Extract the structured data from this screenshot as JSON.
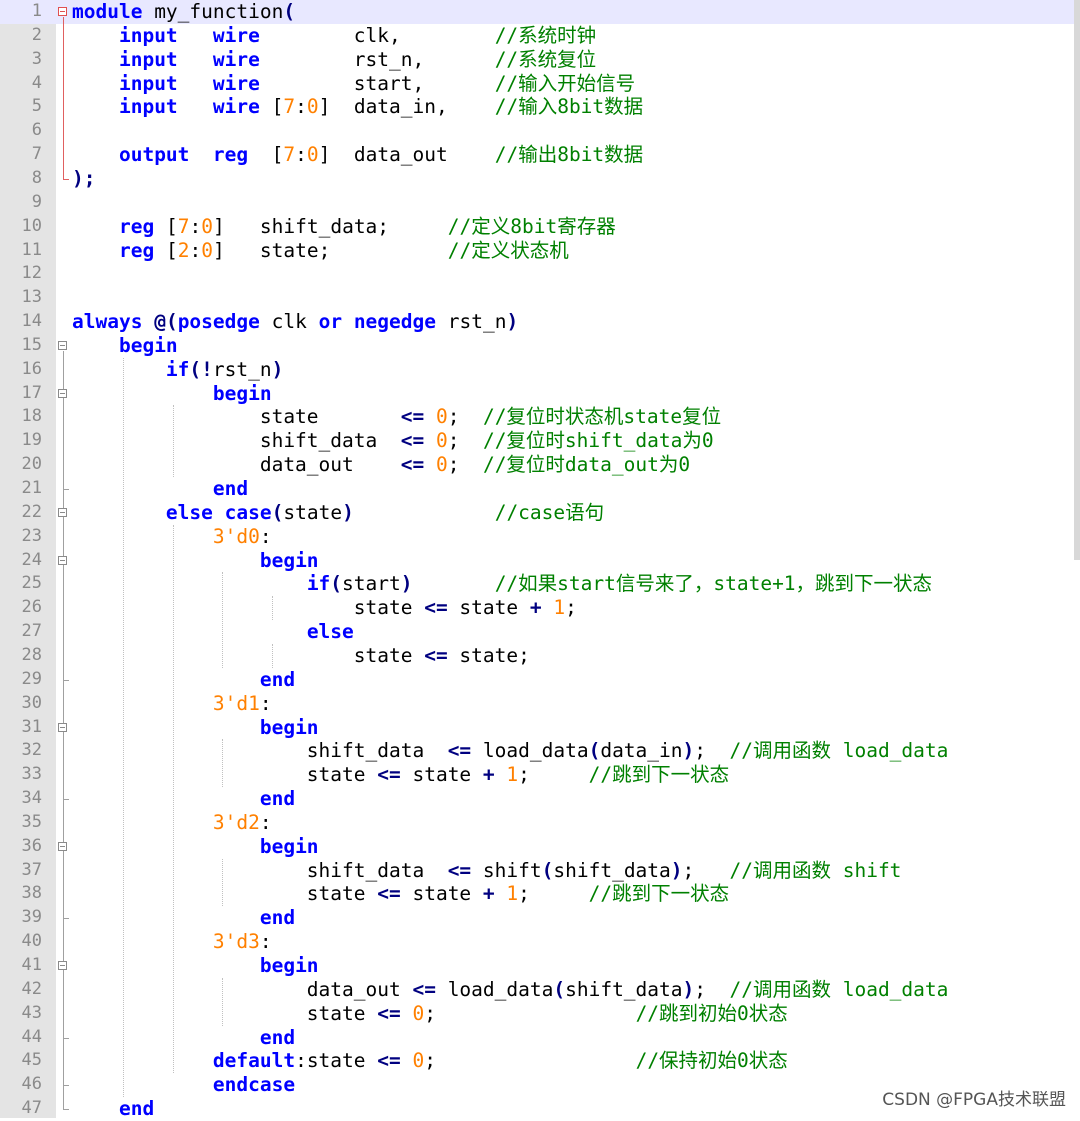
{
  "editor": {
    "current_line": 1,
    "lines": [
      {
        "n": "1",
        "tokens": [
          {
            "t": "kw",
            "v": "module"
          },
          {
            "t": "tx",
            "v": " my_function"
          },
          {
            "t": "op",
            "v": "("
          }
        ]
      },
      {
        "n": "2",
        "tokens": [
          {
            "t": "tx",
            "v": "    "
          },
          {
            "t": "kw",
            "v": "input"
          },
          {
            "t": "tx",
            "v": "   "
          },
          {
            "t": "kw",
            "v": "wire"
          },
          {
            "t": "tx",
            "v": "        clk,        "
          },
          {
            "t": "cm",
            "v": "//系统时钟"
          }
        ]
      },
      {
        "n": "3",
        "tokens": [
          {
            "t": "tx",
            "v": "    "
          },
          {
            "t": "kw",
            "v": "input"
          },
          {
            "t": "tx",
            "v": "   "
          },
          {
            "t": "kw",
            "v": "wire"
          },
          {
            "t": "tx",
            "v": "        rst_n,      "
          },
          {
            "t": "cm",
            "v": "//系统复位"
          }
        ]
      },
      {
        "n": "4",
        "tokens": [
          {
            "t": "tx",
            "v": "    "
          },
          {
            "t": "kw",
            "v": "input"
          },
          {
            "t": "tx",
            "v": "   "
          },
          {
            "t": "kw",
            "v": "wire"
          },
          {
            "t": "tx",
            "v": "        start,      "
          },
          {
            "t": "cm",
            "v": "//输入开始信号"
          }
        ]
      },
      {
        "n": "5",
        "tokens": [
          {
            "t": "tx",
            "v": "    "
          },
          {
            "t": "kw",
            "v": "input"
          },
          {
            "t": "tx",
            "v": "   "
          },
          {
            "t": "kw",
            "v": "wire"
          },
          {
            "t": "tx",
            "v": " ["
          },
          {
            "t": "num",
            "v": "7"
          },
          {
            "t": "tx",
            "v": ":"
          },
          {
            "t": "num",
            "v": "0"
          },
          {
            "t": "tx",
            "v": "]  data_in,    "
          },
          {
            "t": "cm",
            "v": "//输入8bit数据"
          }
        ]
      },
      {
        "n": "6",
        "tokens": []
      },
      {
        "n": "7",
        "tokens": [
          {
            "t": "tx",
            "v": "    "
          },
          {
            "t": "kw",
            "v": "output"
          },
          {
            "t": "tx",
            "v": "  "
          },
          {
            "t": "kw",
            "v": "reg"
          },
          {
            "t": "tx",
            "v": "  ["
          },
          {
            "t": "num",
            "v": "7"
          },
          {
            "t": "tx",
            "v": ":"
          },
          {
            "t": "num",
            "v": "0"
          },
          {
            "t": "tx",
            "v": "]  data_out    "
          },
          {
            "t": "cm",
            "v": "//输出8bit数据"
          }
        ]
      },
      {
        "n": "8",
        "tokens": [
          {
            "t": "op",
            "v": ");"
          }
        ]
      },
      {
        "n": "9",
        "tokens": []
      },
      {
        "n": "10",
        "tokens": [
          {
            "t": "tx",
            "v": "    "
          },
          {
            "t": "kw",
            "v": "reg"
          },
          {
            "t": "tx",
            "v": " ["
          },
          {
            "t": "num",
            "v": "7"
          },
          {
            "t": "tx",
            "v": ":"
          },
          {
            "t": "num",
            "v": "0"
          },
          {
            "t": "tx",
            "v": "]   shift_data;     "
          },
          {
            "t": "cm",
            "v": "//定义8bit寄存器"
          }
        ]
      },
      {
        "n": "11",
        "tokens": [
          {
            "t": "tx",
            "v": "    "
          },
          {
            "t": "kw",
            "v": "reg"
          },
          {
            "t": "tx",
            "v": " ["
          },
          {
            "t": "num",
            "v": "2"
          },
          {
            "t": "tx",
            "v": ":"
          },
          {
            "t": "num",
            "v": "0"
          },
          {
            "t": "tx",
            "v": "]   state;          "
          },
          {
            "t": "cm",
            "v": "//定义状态机"
          }
        ]
      },
      {
        "n": "12",
        "tokens": []
      },
      {
        "n": "13",
        "tokens": []
      },
      {
        "n": "14",
        "tokens": [
          {
            "t": "kw",
            "v": "always"
          },
          {
            "t": "tx",
            "v": " "
          },
          {
            "t": "op",
            "v": "@("
          },
          {
            "t": "kw",
            "v": "posedge"
          },
          {
            "t": "tx",
            "v": " clk "
          },
          {
            "t": "kw",
            "v": "or"
          },
          {
            "t": "tx",
            "v": " "
          },
          {
            "t": "kw",
            "v": "negedge"
          },
          {
            "t": "tx",
            "v": " rst_n"
          },
          {
            "t": "op",
            "v": ")"
          }
        ]
      },
      {
        "n": "15",
        "tokens": [
          {
            "t": "tx",
            "v": "    "
          },
          {
            "t": "kw",
            "v": "begin"
          }
        ]
      },
      {
        "n": "16",
        "tokens": [
          {
            "t": "tx",
            "v": "        "
          },
          {
            "t": "kw",
            "v": "if"
          },
          {
            "t": "op",
            "v": "(!"
          },
          {
            "t": "tx",
            "v": "rst_n"
          },
          {
            "t": "op",
            "v": ")"
          }
        ]
      },
      {
        "n": "17",
        "tokens": [
          {
            "t": "tx",
            "v": "            "
          },
          {
            "t": "kw",
            "v": "begin"
          }
        ]
      },
      {
        "n": "18",
        "tokens": [
          {
            "t": "tx",
            "v": "                state       "
          },
          {
            "t": "op",
            "v": "<="
          },
          {
            "t": "tx",
            "v": " "
          },
          {
            "t": "num",
            "v": "0"
          },
          {
            "t": "tx",
            "v": ";  "
          },
          {
            "t": "cm",
            "v": "//复位时状态机state复位"
          }
        ]
      },
      {
        "n": "19",
        "tokens": [
          {
            "t": "tx",
            "v": "                shift_data  "
          },
          {
            "t": "op",
            "v": "<="
          },
          {
            "t": "tx",
            "v": " "
          },
          {
            "t": "num",
            "v": "0"
          },
          {
            "t": "tx",
            "v": ";  "
          },
          {
            "t": "cm",
            "v": "//复位时shift_data为0"
          }
        ]
      },
      {
        "n": "20",
        "tokens": [
          {
            "t": "tx",
            "v": "                data_out    "
          },
          {
            "t": "op",
            "v": "<="
          },
          {
            "t": "tx",
            "v": " "
          },
          {
            "t": "num",
            "v": "0"
          },
          {
            "t": "tx",
            "v": ";  "
          },
          {
            "t": "cm",
            "v": "//复位时data_out为0"
          }
        ]
      },
      {
        "n": "21",
        "tokens": [
          {
            "t": "tx",
            "v": "            "
          },
          {
            "t": "kw",
            "v": "end"
          }
        ]
      },
      {
        "n": "22",
        "tokens": [
          {
            "t": "tx",
            "v": "        "
          },
          {
            "t": "kw",
            "v": "else"
          },
          {
            "t": "tx",
            "v": " "
          },
          {
            "t": "kw",
            "v": "case"
          },
          {
            "t": "op",
            "v": "("
          },
          {
            "t": "tx",
            "v": "state"
          },
          {
            "t": "op",
            "v": ")"
          },
          {
            "t": "tx",
            "v": "            "
          },
          {
            "t": "cm",
            "v": "//case语句"
          }
        ]
      },
      {
        "n": "23",
        "tokens": [
          {
            "t": "tx",
            "v": "            "
          },
          {
            "t": "num",
            "v": "3'd0"
          },
          {
            "t": "tx",
            "v": ":"
          }
        ]
      },
      {
        "n": "24",
        "tokens": [
          {
            "t": "tx",
            "v": "                "
          },
          {
            "t": "kw",
            "v": "begin"
          }
        ]
      },
      {
        "n": "25",
        "tokens": [
          {
            "t": "tx",
            "v": "                    "
          },
          {
            "t": "kw",
            "v": "if"
          },
          {
            "t": "op",
            "v": "("
          },
          {
            "t": "tx",
            "v": "start"
          },
          {
            "t": "op",
            "v": ")"
          },
          {
            "t": "tx",
            "v": "       "
          },
          {
            "t": "cm",
            "v": "//如果start信号来了，state+1，跳到下一状态"
          }
        ]
      },
      {
        "n": "26",
        "tokens": [
          {
            "t": "tx",
            "v": "                        state "
          },
          {
            "t": "op",
            "v": "<="
          },
          {
            "t": "tx",
            "v": " state "
          },
          {
            "t": "op",
            "v": "+"
          },
          {
            "t": "tx",
            "v": " "
          },
          {
            "t": "num",
            "v": "1"
          },
          {
            "t": "tx",
            "v": ";"
          }
        ]
      },
      {
        "n": "27",
        "tokens": [
          {
            "t": "tx",
            "v": "                    "
          },
          {
            "t": "kw",
            "v": "else"
          }
        ]
      },
      {
        "n": "28",
        "tokens": [
          {
            "t": "tx",
            "v": "                        state "
          },
          {
            "t": "op",
            "v": "<="
          },
          {
            "t": "tx",
            "v": " state;"
          }
        ]
      },
      {
        "n": "29",
        "tokens": [
          {
            "t": "tx",
            "v": "                "
          },
          {
            "t": "kw",
            "v": "end"
          }
        ]
      },
      {
        "n": "30",
        "tokens": [
          {
            "t": "tx",
            "v": "            "
          },
          {
            "t": "num",
            "v": "3'd1"
          },
          {
            "t": "tx",
            "v": ":"
          }
        ]
      },
      {
        "n": "31",
        "tokens": [
          {
            "t": "tx",
            "v": "                "
          },
          {
            "t": "kw",
            "v": "begin"
          }
        ]
      },
      {
        "n": "32",
        "tokens": [
          {
            "t": "tx",
            "v": "                    shift_data  "
          },
          {
            "t": "op",
            "v": "<="
          },
          {
            "t": "tx",
            "v": " load_data"
          },
          {
            "t": "op",
            "v": "("
          },
          {
            "t": "tx",
            "v": "data_in"
          },
          {
            "t": "op",
            "v": ")"
          },
          {
            "t": "tx",
            "v": ";  "
          },
          {
            "t": "cm",
            "v": "//调用函数 load_data"
          }
        ]
      },
      {
        "n": "33",
        "tokens": [
          {
            "t": "tx",
            "v": "                    state "
          },
          {
            "t": "op",
            "v": "<="
          },
          {
            "t": "tx",
            "v": " state "
          },
          {
            "t": "op",
            "v": "+"
          },
          {
            "t": "tx",
            "v": " "
          },
          {
            "t": "num",
            "v": "1"
          },
          {
            "t": "tx",
            "v": ";     "
          },
          {
            "t": "cm",
            "v": "//跳到下一状态"
          }
        ]
      },
      {
        "n": "34",
        "tokens": [
          {
            "t": "tx",
            "v": "                "
          },
          {
            "t": "kw",
            "v": "end"
          }
        ]
      },
      {
        "n": "35",
        "tokens": [
          {
            "t": "tx",
            "v": "            "
          },
          {
            "t": "num",
            "v": "3'd2"
          },
          {
            "t": "tx",
            "v": ":"
          }
        ]
      },
      {
        "n": "36",
        "tokens": [
          {
            "t": "tx",
            "v": "                "
          },
          {
            "t": "kw",
            "v": "begin"
          }
        ]
      },
      {
        "n": "37",
        "tokens": [
          {
            "t": "tx",
            "v": "                    shift_data  "
          },
          {
            "t": "op",
            "v": "<="
          },
          {
            "t": "tx",
            "v": " shift"
          },
          {
            "t": "op",
            "v": "("
          },
          {
            "t": "tx",
            "v": "shift_data"
          },
          {
            "t": "op",
            "v": ")"
          },
          {
            "t": "tx",
            "v": ";   "
          },
          {
            "t": "cm",
            "v": "//调用函数 shift"
          }
        ]
      },
      {
        "n": "38",
        "tokens": [
          {
            "t": "tx",
            "v": "                    state "
          },
          {
            "t": "op",
            "v": "<="
          },
          {
            "t": "tx",
            "v": " state "
          },
          {
            "t": "op",
            "v": "+"
          },
          {
            "t": "tx",
            "v": " "
          },
          {
            "t": "num",
            "v": "1"
          },
          {
            "t": "tx",
            "v": ";     "
          },
          {
            "t": "cm",
            "v": "//跳到下一状态"
          }
        ]
      },
      {
        "n": "39",
        "tokens": [
          {
            "t": "tx",
            "v": "                "
          },
          {
            "t": "kw",
            "v": "end"
          }
        ]
      },
      {
        "n": "40",
        "tokens": [
          {
            "t": "tx",
            "v": "            "
          },
          {
            "t": "num",
            "v": "3'd3"
          },
          {
            "t": "tx",
            "v": ":"
          }
        ]
      },
      {
        "n": "41",
        "tokens": [
          {
            "t": "tx",
            "v": "                "
          },
          {
            "t": "kw",
            "v": "begin"
          }
        ]
      },
      {
        "n": "42",
        "tokens": [
          {
            "t": "tx",
            "v": "                    data_out "
          },
          {
            "t": "op",
            "v": "<="
          },
          {
            "t": "tx",
            "v": " load_data"
          },
          {
            "t": "op",
            "v": "("
          },
          {
            "t": "tx",
            "v": "shift_data"
          },
          {
            "t": "op",
            "v": ")"
          },
          {
            "t": "tx",
            "v": ";  "
          },
          {
            "t": "cm",
            "v": "//调用函数 load_data"
          }
        ]
      },
      {
        "n": "43",
        "tokens": [
          {
            "t": "tx",
            "v": "                    state "
          },
          {
            "t": "op",
            "v": "<="
          },
          {
            "t": "tx",
            "v": " "
          },
          {
            "t": "num",
            "v": "0"
          },
          {
            "t": "tx",
            "v": ";                 "
          },
          {
            "t": "cm",
            "v": "//跳到初始0状态"
          }
        ]
      },
      {
        "n": "44",
        "tokens": [
          {
            "t": "tx",
            "v": "                "
          },
          {
            "t": "kw",
            "v": "end"
          }
        ]
      },
      {
        "n": "45",
        "tokens": [
          {
            "t": "tx",
            "v": "            "
          },
          {
            "t": "kw",
            "v": "default"
          },
          {
            "t": "tx",
            "v": ":state "
          },
          {
            "t": "op",
            "v": "<="
          },
          {
            "t": "tx",
            "v": " "
          },
          {
            "t": "num",
            "v": "0"
          },
          {
            "t": "tx",
            "v": ";                 "
          },
          {
            "t": "cm",
            "v": "//保持初始0状态"
          }
        ]
      },
      {
        "n": "46",
        "tokens": [
          {
            "t": "tx",
            "v": "            "
          },
          {
            "t": "kw",
            "v": "endcase"
          }
        ]
      },
      {
        "n": "47",
        "tokens": [
          {
            "t": "tx",
            "v": "    "
          },
          {
            "t": "kw",
            "v": "end"
          }
        ]
      }
    ]
  },
  "watermark": "CSDN @FPGA技术联盟",
  "colors": {
    "keyword": "#0000ff",
    "operator": "#000080",
    "number": "#ff8000",
    "comment": "#008000",
    "gutter": "#e4e4e4",
    "current_line": "#e8e8ff"
  }
}
